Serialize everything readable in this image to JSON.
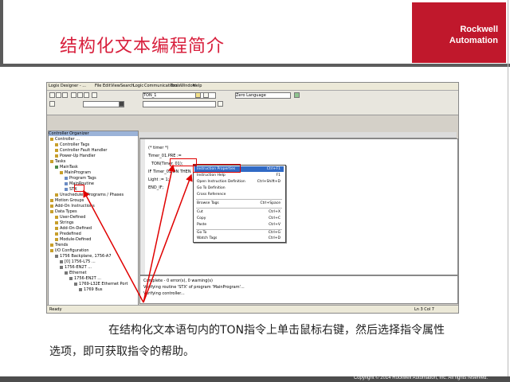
{
  "slide": {
    "title": "结构化文本编程简介",
    "logo_line1": "Rockwell",
    "logo_line2": "Automation",
    "caption": "在结构化文本语句内的TON指令上单击鼠标右键，然后选择指令属性选项，即可获取指令的帮助。",
    "footer": "Copyright © 2014 Rockwell Automation, Inc. All rights reserved."
  },
  "ide": {
    "menu": [
      "Logix Designer - ...",
      "File",
      "Edit",
      "View",
      "Search",
      "Logic",
      "Communications",
      "Tools",
      "Window",
      "Help"
    ],
    "combo_tags": "TON_1",
    "combo_lang": "Zero Language",
    "tree_header": "Controller Organizer",
    "tree_items": [
      "Controller ...",
      "Controller Tags",
      "Controller Fault Handler",
      "Power-Up Handler",
      "Tasks",
      "MainTask",
      "MainProgram",
      "Program Tags",
      "MainRoutine",
      "STX",
      "Unscheduled Programs / Phases",
      "Motion Groups",
      "Add-On Instructions",
      "Data Types",
      "User-Defined",
      "Strings",
      "Add-On-Defined",
      "Predefined",
      "Module-Defined",
      "Trends",
      "I/O Configuration",
      "1756 Backplane, 1756-A7",
      "[0] 1756-L75 ...",
      "1756-EN2T ...",
      "Ethernet",
      "1756-EN2T ...",
      "1769-L32E Ethernet Port",
      "1769 Bus"
    ],
    "code_lines": [
      "(* timer *)",
      "Timer_01.PRE :=",
      "TON(Timer_01);",
      "IF Timer_01.DN THEN",
      "  Light := 1;",
      "END_IF;"
    ],
    "context_menu": [
      {
        "label": "Instruction Properties",
        "hotkey": "Ctrl+F1"
      },
      {
        "label": "Instruction Help",
        "hotkey": "F1"
      },
      {
        "label": "Open Instruction Definition",
        "hotkey": "Ctrl+Shift+D"
      },
      {
        "label": "Go To Definition",
        "hotkey": ""
      },
      {
        "label": "Cross Reference",
        "hotkey": ""
      },
      {
        "label": "Browse Tags",
        "hotkey": "Ctrl+Space"
      },
      {
        "label": "Cut",
        "hotkey": "Ctrl+X"
      },
      {
        "label": "Copy",
        "hotkey": "Ctrl+C"
      },
      {
        "label": "Paste",
        "hotkey": "Ctrl+V"
      },
      {
        "label": "Go To",
        "hotkey": "Ctrl+G"
      },
      {
        "label": "Watch Tags",
        "hotkey": "Ctrl+D"
      }
    ],
    "output_lines": [
      "Complete - 0 error(s), 0 warning(s)",
      "Verifying routine 'STX' of program 'MainProgram'...",
      "Verifying controller..."
    ],
    "status_text": "Ready",
    "status_pos": "Ln 3  Col 7"
  },
  "colors": {
    "title": "#d81f3c",
    "logo_bg": "#c0182c",
    "arrow": "#e00000",
    "menu_highlight": "#316ac5"
  }
}
